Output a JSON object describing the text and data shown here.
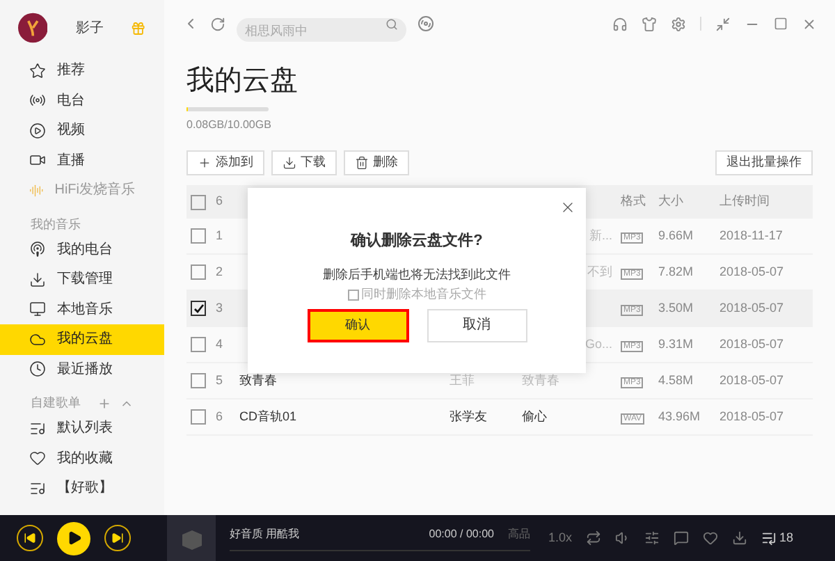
{
  "user": {
    "name": "影子"
  },
  "nav": [
    {
      "kind": "star",
      "label": "推荐",
      "selected": false,
      "dim": false
    },
    {
      "kind": "radio",
      "label": "电台",
      "selected": false,
      "dim": false
    },
    {
      "kind": "video",
      "label": "视频",
      "selected": false,
      "dim": false
    },
    {
      "kind": "live",
      "label": "直播",
      "selected": false,
      "dim": false
    },
    {
      "kind": "hifi",
      "label": "HiFi发烧音乐",
      "selected": false,
      "dim": true
    }
  ],
  "my_music": {
    "title": "我的音乐",
    "items": [
      {
        "kind": "podcast",
        "label": "我的电台",
        "selected": false
      },
      {
        "kind": "download",
        "label": "下载管理",
        "selected": false
      },
      {
        "kind": "monitor",
        "label": "本地音乐",
        "selected": false
      },
      {
        "kind": "cloud",
        "label": "我的云盘",
        "selected": true
      },
      {
        "kind": "clock",
        "label": "最近播放",
        "selected": false
      }
    ]
  },
  "playlists": {
    "title": "自建歌单",
    "items": [
      {
        "kind": "list",
        "label": "默认列表"
      },
      {
        "kind": "heart",
        "label": "我的收藏"
      },
      {
        "kind": "list",
        "label": "【好歌】"
      }
    ]
  },
  "search": {
    "placeholder": "相思风雨中"
  },
  "page": {
    "title": "我的云盘",
    "storage": "0.08GB/10.00GB",
    "level": 0.01
  },
  "toolbar": [
    "添加到",
    "下载",
    "删除"
  ],
  "exit_batch": "退出批量操作",
  "table": {
    "count": "6",
    "all_checked": false,
    "columns": [
      "格式",
      "大小",
      "上传时间"
    ],
    "rows": [
      {
        "num": "1",
        "title": "",
        "artist": "",
        "album": "新...",
        "format": "MP3",
        "size": "9.66M",
        "time": "2018-11-17",
        "checked": false
      },
      {
        "num": "2",
        "title": "",
        "artist": "",
        "album": "不到",
        "format": "MP3",
        "size": "7.82M",
        "time": "2018-05-07",
        "checked": false
      },
      {
        "num": "3",
        "title": "",
        "artist": "",
        "album": "",
        "format": "MP3",
        "size": "3.50M",
        "time": "2018-05-07",
        "checked": true
      },
      {
        "num": "4",
        "title": "",
        "artist": "",
        "album": "Go...",
        "format": "MP3",
        "size": "9.31M",
        "time": "2018-05-07",
        "checked": false
      },
      {
        "num": "5",
        "title": "致青春",
        "artist": "王菲",
        "album": "致青春",
        "format": "MP3",
        "size": "4.58M",
        "time": "2018-05-07",
        "checked": false,
        "dim": true
      },
      {
        "num": "6",
        "title": "CD音轨01",
        "artist": "张学友",
        "album": "偷心",
        "format": "WAV",
        "size": "43.96M",
        "time": "2018-05-07",
        "checked": false,
        "dim": false
      }
    ]
  },
  "dialog": {
    "title": "确认删除云盘文件?",
    "message": "删除后手机端也将无法找到此文件",
    "option": {
      "label": "同时删除本地音乐文件",
      "checked": false
    },
    "confirm": "确认",
    "cancel": "取消"
  },
  "player": {
    "song": "好音质 用酷我",
    "time": "00:00 / 00:00",
    "quality": "高品",
    "speed": "1.0x",
    "count": "18"
  }
}
